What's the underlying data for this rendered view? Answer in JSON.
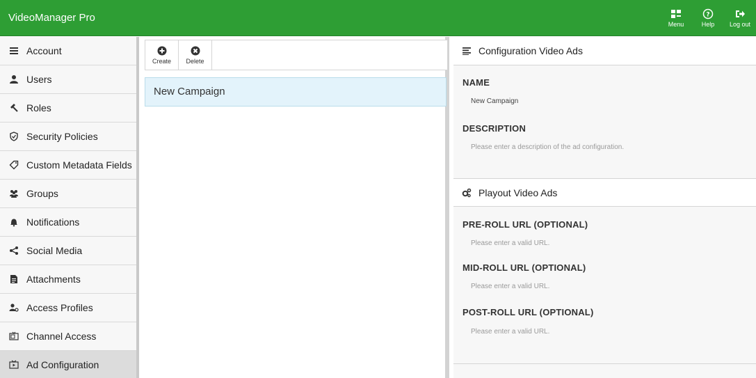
{
  "app": {
    "title": "VideoManager Pro"
  },
  "topbar": {
    "menu_label": "Menu",
    "help_label": "Help",
    "logout_label": "Log out"
  },
  "sidebar": {
    "items": [
      {
        "label": "Account",
        "icon": "account-icon"
      },
      {
        "label": "Users",
        "icon": "user-icon"
      },
      {
        "label": "Roles",
        "icon": "gavel-icon"
      },
      {
        "label": "Security Policies",
        "icon": "shield-icon"
      },
      {
        "label": "Custom Metadata Fields",
        "icon": "tag-icon"
      },
      {
        "label": "Groups",
        "icon": "group-icon"
      },
      {
        "label": "Notifications",
        "icon": "bell-icon"
      },
      {
        "label": "Social Media",
        "icon": "share-icon"
      },
      {
        "label": "Attachments",
        "icon": "file-icon"
      },
      {
        "label": "Access Profiles",
        "icon": "access-profile-icon"
      },
      {
        "label": "Channel Access",
        "icon": "channel-icon"
      },
      {
        "label": "Ad Configuration",
        "icon": "ad-icon",
        "active": true
      }
    ]
  },
  "toolbar": {
    "create_label": "Create",
    "delete_label": "Delete"
  },
  "list": {
    "items": [
      {
        "label": "New Campaign"
      }
    ]
  },
  "config": {
    "header": "Configuration Video Ads",
    "name_label": "NAME",
    "name_value": "New Campaign",
    "description_label": "DESCRIPTION",
    "description_placeholder": "Please enter a description of the ad configuration."
  },
  "playout": {
    "header": "Playout Video Ads",
    "preroll_label": "PRE-ROLL URL (OPTIONAL)",
    "preroll_placeholder": "Please enter a valid URL.",
    "midroll_label": "MID-ROLL URL (OPTIONAL)",
    "midroll_placeholder": "Please enter a valid URL.",
    "postroll_label": "POST-ROLL URL (OPTIONAL)",
    "postroll_placeholder": "Please enter a valid URL."
  },
  "colors": {
    "brand_green": "#2e9e34",
    "selected_row": "#e3f3fb",
    "active_sidebar": "#dcdcdc"
  }
}
